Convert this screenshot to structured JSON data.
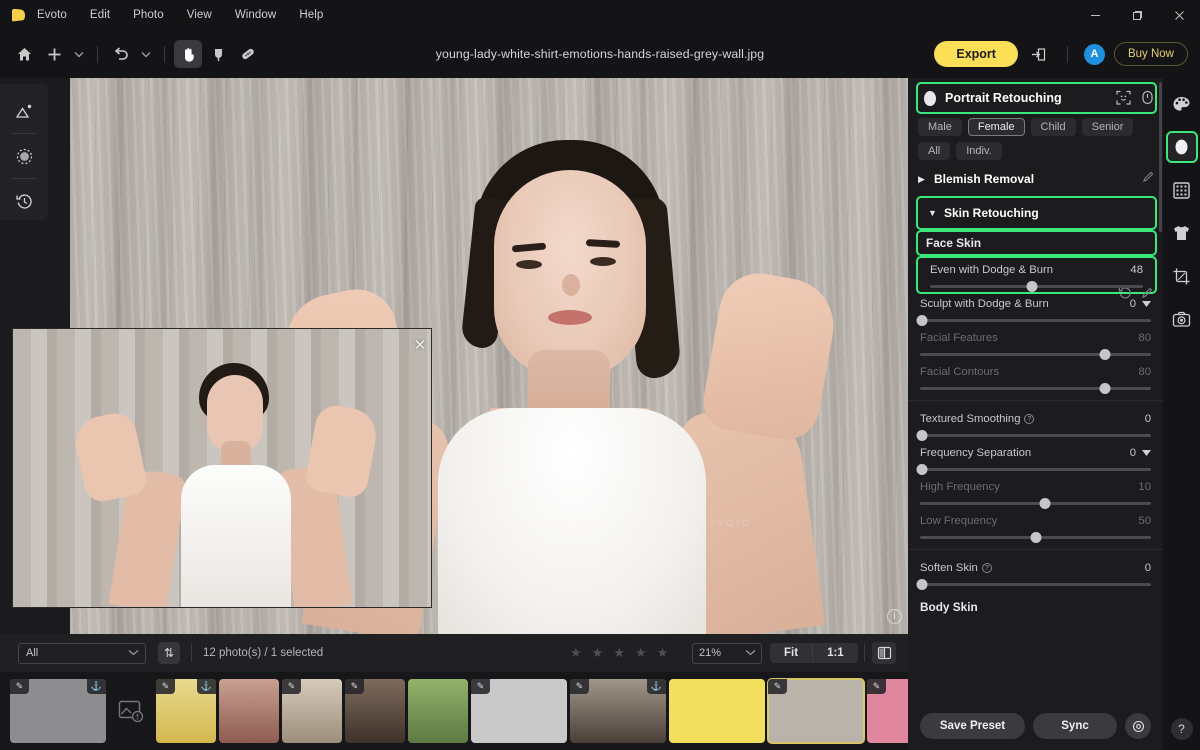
{
  "app": {
    "name": "Evoto"
  },
  "menubar": {
    "items": [
      "Evoto",
      "Edit",
      "Photo",
      "View",
      "Window",
      "Help"
    ]
  },
  "window_controls": {
    "minimize": "—",
    "maximize": "❐",
    "close": "✕"
  },
  "toolbar": {
    "home_icon": "home-icon",
    "add_icon": "+",
    "add_chevron": "⌄",
    "undo_icon": "↶",
    "undo_chevron": "⌄",
    "hand_icon": "hand-tool",
    "retouch_icon": "retouch-brush-tool",
    "heal_icon": "healing-patch-tool",
    "file_title": "young-lady-white-shirt-emotions-hands-raised-grey-wall.jpg",
    "export_label": "Export",
    "share_icon": "share-export-icon",
    "avatar_initial": "A",
    "buynow_label": "Buy Now"
  },
  "left_rail": {
    "items": [
      {
        "name": "image-adjust-icon",
        "glyph": "⛰"
      },
      {
        "name": "mask-brush-icon",
        "glyph": "◌"
      },
      {
        "name": "history-icon",
        "glyph": "↺"
      }
    ]
  },
  "canvas": {
    "preview_close": "✕",
    "info_icon": "i",
    "watermark": "EVOTO"
  },
  "bottombar": {
    "filter_value": "All",
    "filter_chevron": "⌄",
    "sort_icon": "⇅",
    "photo_count": "12 photo(s) / 1 selected",
    "stars": [
      "★",
      "★",
      "★",
      "★",
      "★"
    ],
    "zoom_value": "21%",
    "zoom_chevron": "⌄",
    "fit_label": "Fit",
    "one_to_one_label": "1:1",
    "compare_icon": "compare-split-icon"
  },
  "filmstrip": {
    "placeholder_icon": "missing-image-icon",
    "badge_edit": "✎",
    "badge_export": "⚓",
    "thumbs": [
      {
        "name": "thumb-1",
        "bg": "#8d8d8f",
        "selected": false,
        "wide": true,
        "edit": true,
        "exp": true
      },
      {
        "name": "thumb-2",
        "bg": "#d9c46a",
        "selected": false,
        "wide": false,
        "edit": true,
        "exp": true
      },
      {
        "name": "thumb-3",
        "bg": "#c9a091",
        "selected": false,
        "wide": false,
        "edit": false,
        "exp": false
      },
      {
        "name": "thumb-4",
        "bg": "#c3b5a6",
        "selected": false,
        "wide": false,
        "edit": true,
        "exp": false
      },
      {
        "name": "thumb-5",
        "bg": "#6d5a4f",
        "selected": false,
        "wide": false,
        "edit": true,
        "exp": false
      },
      {
        "name": "thumb-6",
        "bg": "#7fa05c",
        "selected": false,
        "wide": false,
        "edit": false,
        "exp": false
      },
      {
        "name": "thumb-7",
        "bg": "#c9c9c9",
        "selected": false,
        "wide": true,
        "edit": true,
        "exp": false
      },
      {
        "name": "thumb-8",
        "bg": "#8f8378",
        "selected": false,
        "wide": true,
        "edit": true,
        "exp": true
      },
      {
        "name": "thumb-9",
        "bg": "#f2df5e",
        "selected": false,
        "wide": true,
        "edit": false,
        "exp": false
      },
      {
        "name": "thumb-10",
        "bg": "#b9b3aa",
        "selected": true,
        "wide": true,
        "edit": true,
        "exp": false
      },
      {
        "name": "thumb-11",
        "bg": "#e0869d",
        "selected": false,
        "wide": true,
        "edit": true,
        "exp": false
      }
    ]
  },
  "panel": {
    "title": "Portrait Retouching",
    "title_highlighted": true,
    "head_icons": [
      {
        "name": "face-detect-icon",
        "glyph": "☺"
      },
      {
        "name": "toggle-effect-icon",
        "glyph": "⌀"
      }
    ],
    "chips": [
      {
        "label": "Male",
        "selected": false
      },
      {
        "label": "Female",
        "selected": true
      },
      {
        "label": "Child",
        "selected": false
      },
      {
        "label": "Senior",
        "selected": false
      },
      {
        "label": "All",
        "selected": false
      },
      {
        "label": "Indiv.",
        "selected": false
      }
    ],
    "sections": [
      {
        "name": "blemish-removal",
        "title": "Blemish Removal",
        "caret": "▶",
        "expanded": false,
        "highlighted": false,
        "icons": [
          {
            "name": "edit-mask-icon",
            "glyph": "✐"
          }
        ]
      },
      {
        "name": "skin-retouching",
        "title": "Skin Retouching",
        "caret": "▼",
        "expanded": true,
        "highlighted": true,
        "icons": [
          {
            "name": "reset-icon",
            "glyph": "↺"
          },
          {
            "name": "edit-mask-icon",
            "glyph": "✐"
          }
        ]
      }
    ],
    "face_skin_label": "Face Skin",
    "face_skin_highlighted": true,
    "body_skin_label": "Body Skin",
    "sliders": [
      {
        "name": "even-with-dodge-and-burn",
        "label": "Even with Dodge & Burn",
        "value": "48",
        "pct": 48,
        "dim": false,
        "has_caret": false,
        "has_info": false,
        "highlighted": true
      },
      {
        "name": "sculpt-with-dodge-and-burn",
        "label": "Sculpt with Dodge & Burn",
        "value": "0",
        "pct": 0,
        "dim": false,
        "has_caret": true,
        "has_info": false,
        "highlighted": false
      },
      {
        "name": "facial-features",
        "label": "Facial Features",
        "value": "80",
        "pct": 80,
        "dim": true,
        "has_caret": false,
        "has_info": false,
        "highlighted": false
      },
      {
        "name": "facial-contours",
        "label": "Facial Contours",
        "value": "80",
        "pct": 80,
        "dim": true,
        "has_caret": false,
        "has_info": false,
        "highlighted": false
      },
      {
        "name": "textured-smoothing",
        "label": "Textured Smoothing",
        "value": "0",
        "pct": 0,
        "dim": false,
        "has_caret": false,
        "has_info": true,
        "highlighted": false
      },
      {
        "name": "frequency-separation",
        "label": "Frequency Separation",
        "value": "0",
        "pct": 0,
        "dim": false,
        "has_caret": true,
        "has_info": false,
        "highlighted": false
      },
      {
        "name": "high-frequency",
        "label": "High Frequency",
        "value": "10",
        "pct": 54,
        "dim": true,
        "has_caret": false,
        "has_info": false,
        "highlighted": false
      },
      {
        "name": "low-frequency",
        "label": "Low Frequency",
        "value": "50",
        "pct": 50,
        "dim": true,
        "has_caret": false,
        "has_info": false,
        "highlighted": false
      },
      {
        "name": "soften-skin",
        "label": "Soften Skin",
        "value": "0",
        "pct": 0,
        "dim": false,
        "has_caret": false,
        "has_info": true,
        "highlighted": false
      }
    ],
    "footer": {
      "save_preset_label": "Save Preset",
      "sync_label": "Sync",
      "gear_icon": "⊙"
    }
  },
  "right_rail": {
    "items": [
      {
        "name": "color-palette-icon",
        "glyph": "🎨",
        "active": false
      },
      {
        "name": "portrait-face-icon",
        "glyph": "●",
        "active": true
      },
      {
        "name": "background-grid-icon",
        "glyph": "▦",
        "active": false
      },
      {
        "name": "clothing-icon",
        "glyph": "👕",
        "active": false
      },
      {
        "name": "crop-icon",
        "glyph": "⧉",
        "active": false
      },
      {
        "name": "camera-effects-icon",
        "glyph": "◎",
        "active": false
      }
    ],
    "help_label": "?"
  },
  "colors": {
    "accent_yellow": "#fadf57",
    "highlight_green": "#3ce87b",
    "panel_bg": "#1c1c1f",
    "avatar_blue": "#1f8fe0"
  }
}
